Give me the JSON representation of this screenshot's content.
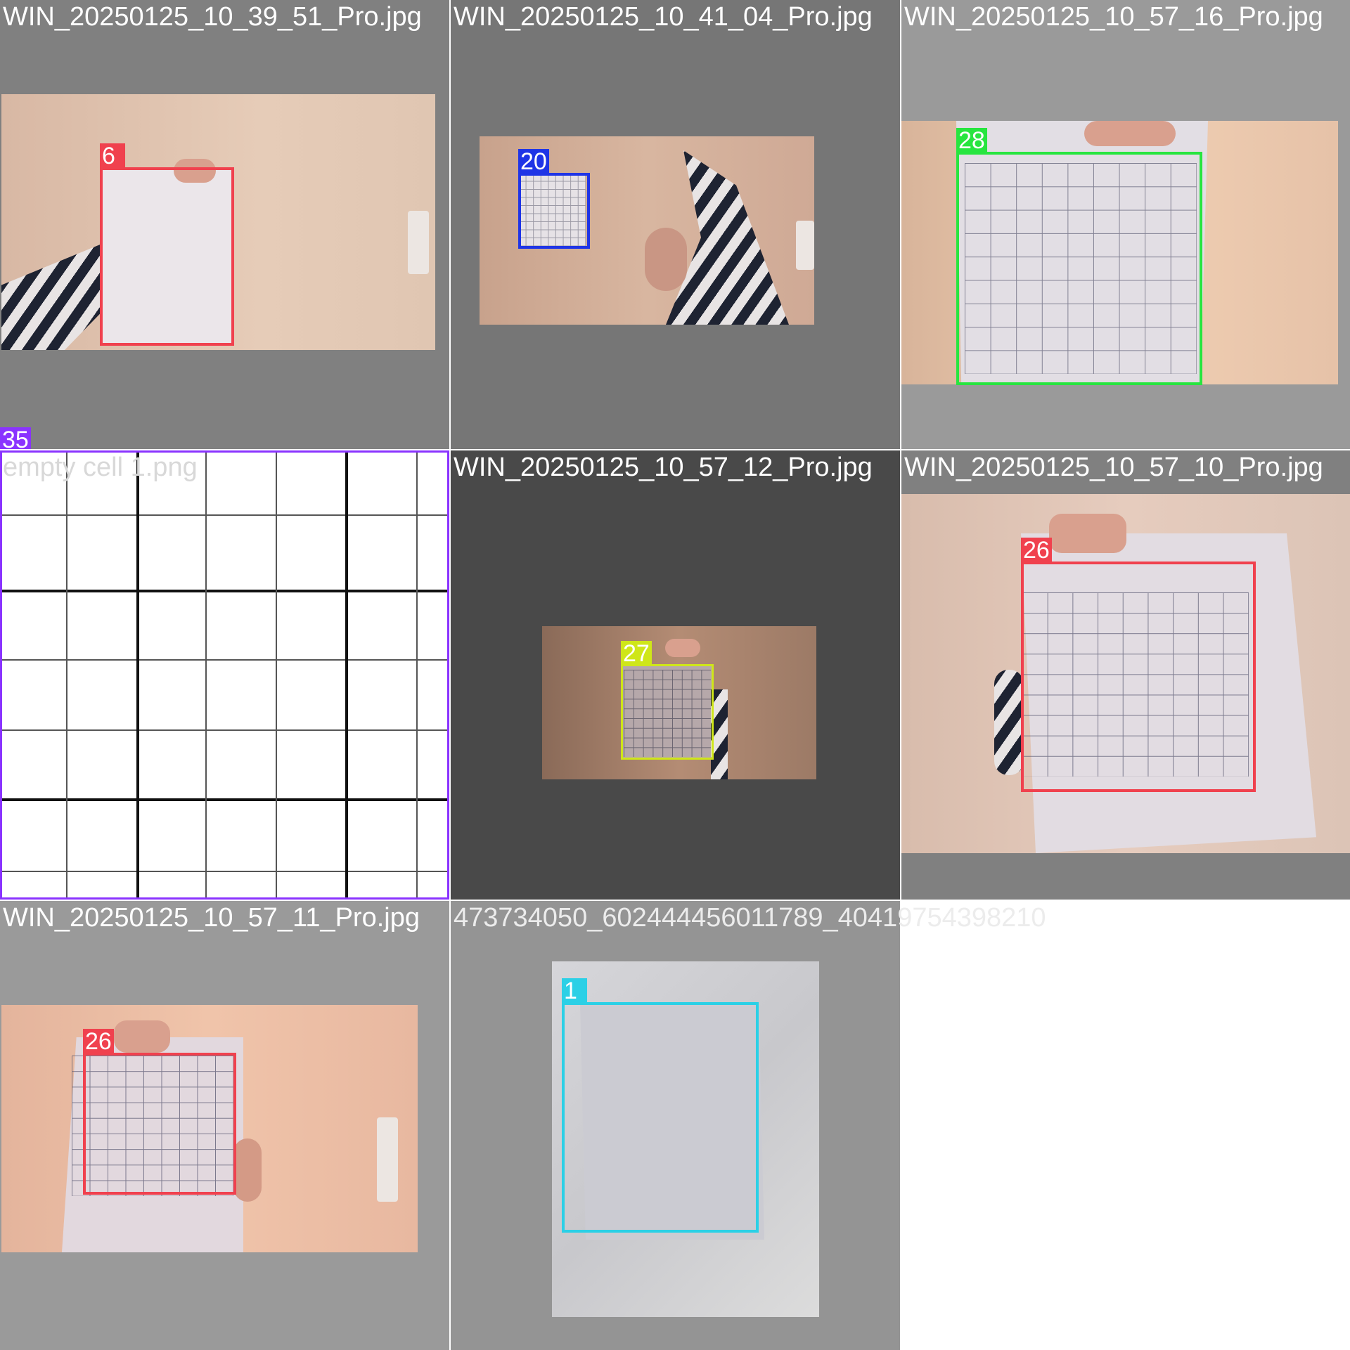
{
  "tiles": [
    {
      "filename": "WIN_20250125_10_39_51_Pro.jpg",
      "label": "6",
      "color": "#f0414e"
    },
    {
      "filename": "WIN_20250125_10_41_04_Pro.jpg",
      "label": "20",
      "color": "#1f35e6"
    },
    {
      "filename": "WIN_20250125_10_57_16_Pro.jpg",
      "label": "28",
      "color": "#27e53f"
    },
    {
      "filename": "empty cell 1.png",
      "label": "35",
      "color": "#8a33ff"
    },
    {
      "filename": "WIN_20250125_10_57_12_Pro.jpg",
      "label": "27",
      "color": "#cfe619"
    },
    {
      "filename": "WIN_20250125_10_57_10_Pro.jpg",
      "label": "26",
      "color": "#f0414e"
    },
    {
      "filename": "WIN_20250125_10_57_11_Pro.jpg",
      "label": "26",
      "color": "#f0414e"
    },
    {
      "filename": "473734050_602444456011789_4041975439821​0",
      "label": "1",
      "color": "#2bd0e6"
    }
  ]
}
